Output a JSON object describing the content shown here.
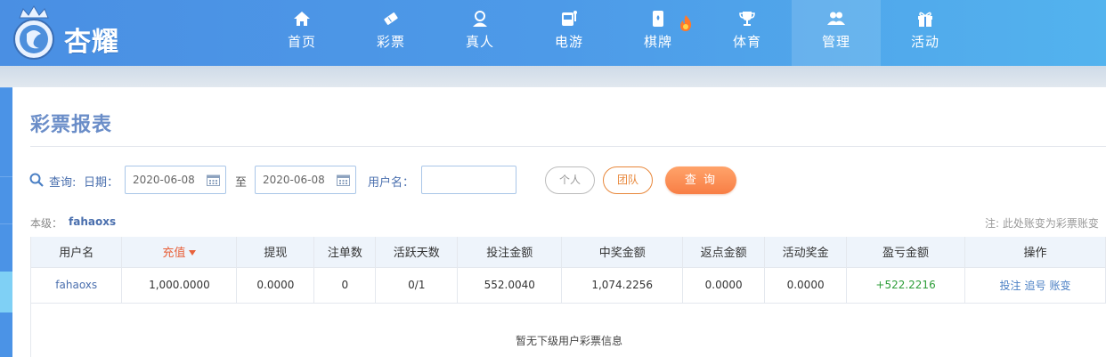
{
  "brand": {
    "name": "杏耀"
  },
  "nav": [
    {
      "label": "首页",
      "icon": "home-icon"
    },
    {
      "label": "彩票",
      "icon": "lottery-ticket-icon"
    },
    {
      "label": "真人",
      "icon": "live-dealer-icon"
    },
    {
      "label": "电游",
      "icon": "slot-machine-icon"
    },
    {
      "label": "棋牌",
      "icon": "poker-card-icon"
    },
    {
      "label": "体育",
      "icon": "trophy-icon"
    },
    {
      "label": "管理",
      "icon": "users-icon"
    },
    {
      "label": "活动",
      "icon": "gift-icon"
    }
  ],
  "page": {
    "title": "彩票报表"
  },
  "filters": {
    "query_label": "查询:",
    "date_label": "日期：",
    "date_from": "2020-06-08",
    "to_label": "至",
    "date_to": "2020-06-08",
    "username_label": "用户名：",
    "username_value": "",
    "personal_label": "个人",
    "team_label": "团队",
    "query_button": "查 询"
  },
  "level": {
    "label": "本级：",
    "value": "fahaoxs"
  },
  "note": "注: 此处账变为彩票账变",
  "table": {
    "headers": [
      "用户名",
      "充值",
      "提现",
      "注单数",
      "活跃天数",
      "投注金额",
      "中奖金额",
      "返点金额",
      "活动奖金",
      "盈亏金额",
      "操作"
    ],
    "row": {
      "username": "fahaoxs",
      "recharge": "1,000.0000",
      "withdraw": "0.0000",
      "orders": "0",
      "active_days": "0/1",
      "bet_amount": "552.0040",
      "win_amount": "1,074.2256",
      "rebate": "0.0000",
      "bonus": "0.0000",
      "profit": "+522.2216",
      "actions": [
        "投注",
        "追号",
        "账变"
      ]
    },
    "empty_message": "暂无下级用户彩票信息"
  },
  "colors": {
    "nav_bg": "#4d9ae8",
    "accent": "#f87e45",
    "title": "#6a8dc8",
    "profit": "#2e9e3a"
  }
}
